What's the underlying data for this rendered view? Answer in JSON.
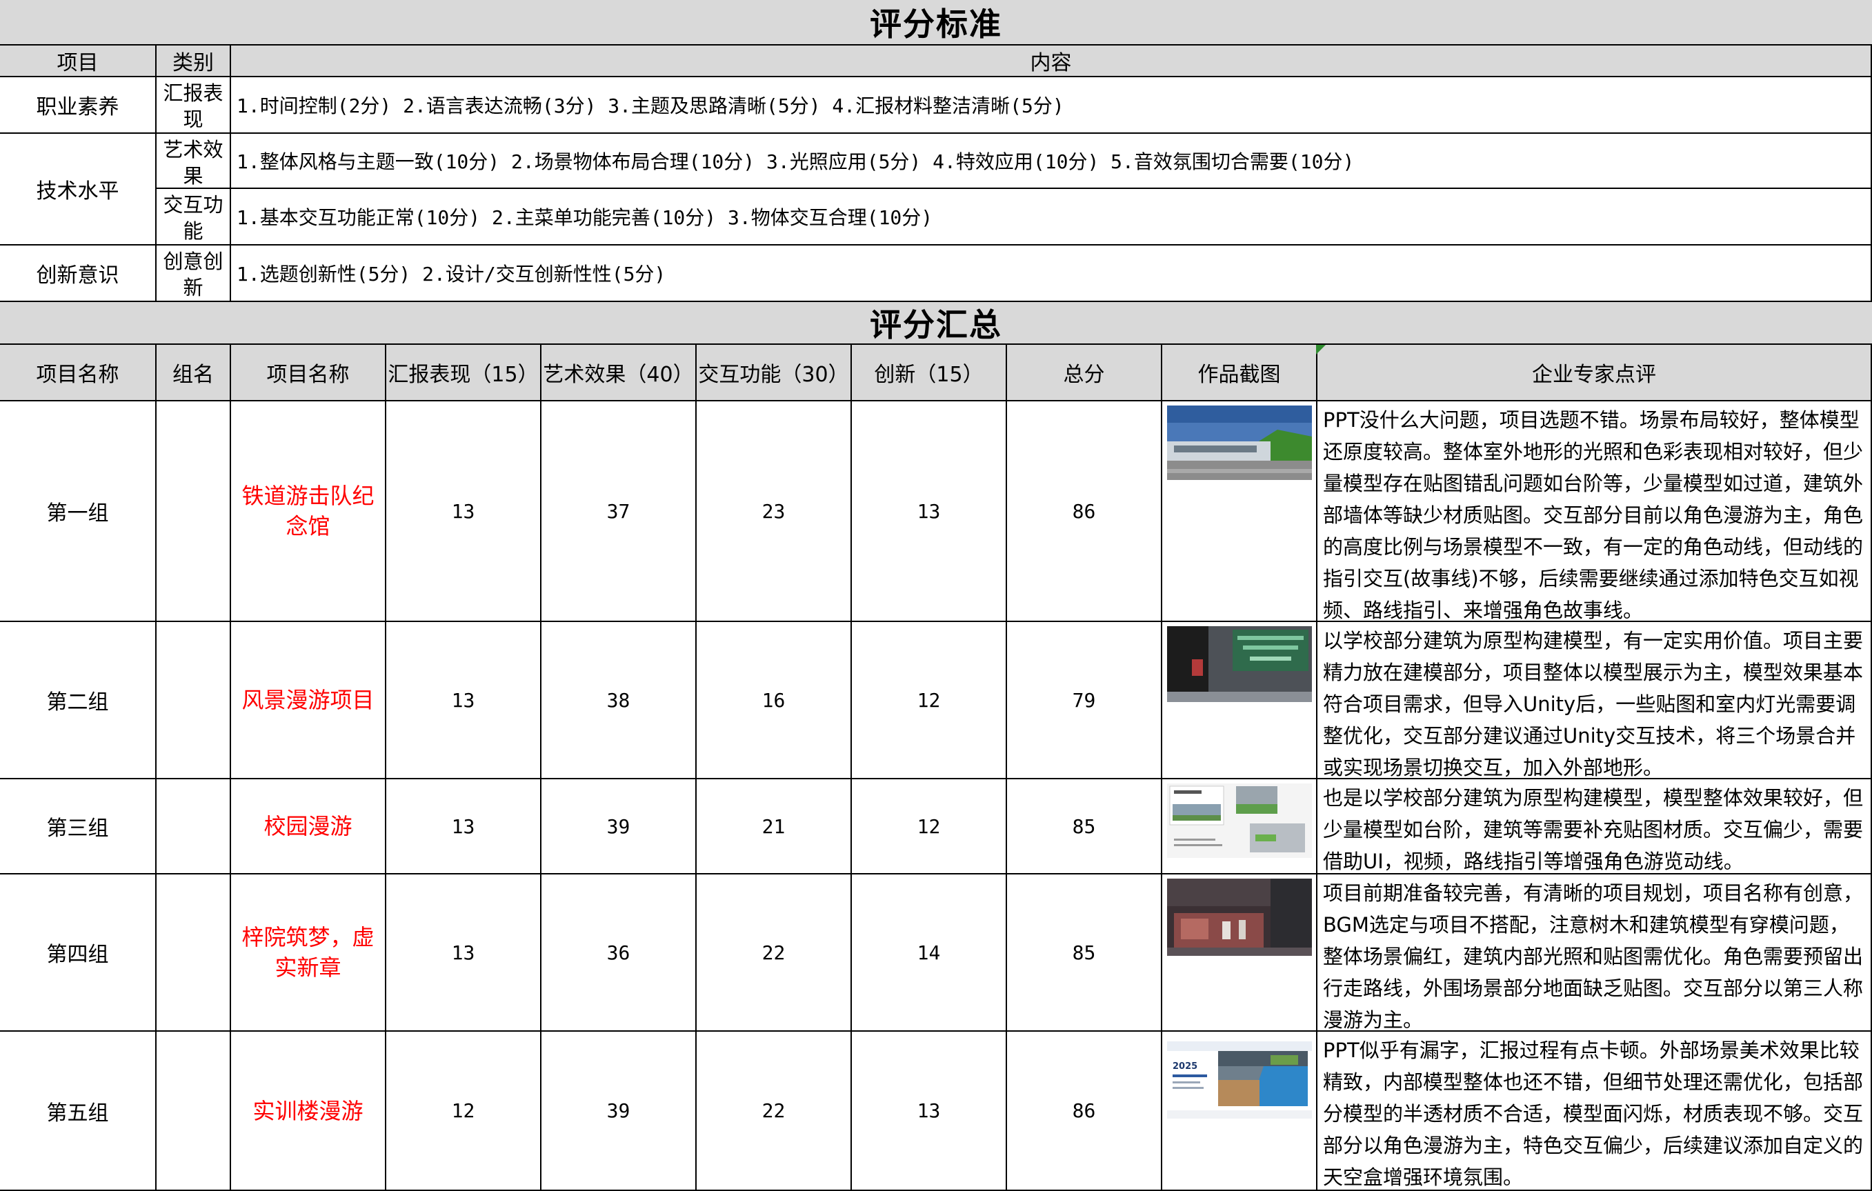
{
  "standard": {
    "title": "评分标准",
    "headers": {
      "item": "项目",
      "category": "类别",
      "content": "内容"
    },
    "rows": [
      {
        "item": "职业素养",
        "category": "汇报表现",
        "content": "1.时间控制(2分) 2.语言表达流畅(3分) 3.主题及思路清晰(5分) 4.汇报材料整洁清晰(5分)"
      },
      {
        "item": "技术水平",
        "category": "艺术效果",
        "content": "1.整体风格与主题一致(10分) 2.场景物体布局合理(10分) 3.光照应用(5分) 4.特效应用(10分) 5.音效氛围切合需要(10分)"
      },
      {
        "item": "",
        "category": "交互功能",
        "content": "1.基本交互功能正常(10分)  2.主菜单功能完善(10分)  3.物体交互合理(10分)"
      },
      {
        "item": "创新意识",
        "category": "创意创新",
        "content": "1.选题创新性(5分)  2.设计/交互创新性性(5分)"
      }
    ]
  },
  "summary": {
    "title": "评分汇总",
    "headers": {
      "group_label": "项目名称",
      "team": "组名",
      "project": "项目名称",
      "report": "汇报表现（15）",
      "art": "艺术效果（40）",
      "interaction": "交互功能（30）",
      "innovation": "创新（15）",
      "total": "总分",
      "screenshot": "作品截图",
      "review": "企业专家点评"
    },
    "rows": [
      {
        "group": "第一组",
        "team": "",
        "project": "铁道游击队纪念馆",
        "report": "13",
        "art": "37",
        "interaction": "23",
        "innovation": "13",
        "total": "86",
        "review": "PPT没什么大问题，项目选题不错。场景布局较好，整体模型还原度较高。整体室外地形的光照和色彩表现相对较好，但少量模型存在贴图错乱问题如台阶等，少量模型如过道，建筑外部墙体等缺少材质贴图。交互部分目前以角色漫游为主，角色的高度比例与场景模型不一致，有一定的角色动线，但动线的指引交互(故事线)不够，后续需要继续通过添加特色交互如视频、路线指引、来增强角色故事线。"
      },
      {
        "group": "第二组",
        "team": "",
        "project": "风景漫游项目",
        "report": "13",
        "art": "38",
        "interaction": "16",
        "innovation": "12",
        "total": "79",
        "review": "以学校部分建筑为原型构建模型，有一定实用价值。项目主要精力放在建模部分，项目整体以模型展示为主，模型效果基本符合项目需求，但导入Unity后，一些贴图和室内灯光需要调整优化，交互部分建议通过Unity交互技术，将三个场景合并或实现场景切换交互，加入外部地形。"
      },
      {
        "group": "第三组",
        "team": "",
        "project": "校园漫游",
        "report": "13",
        "art": "39",
        "interaction": "21",
        "innovation": "12",
        "total": "85",
        "review": "也是以学校部分建筑为原型构建模型，模型整体效果较好，但少量模型如台阶，建筑等需要补充贴图材质。交互偏少，需要借助UI，视频，路线指引等增强角色游览动线。"
      },
      {
        "group": "第四组",
        "team": "",
        "project": "梓院筑梦，虚实新章",
        "report": "13",
        "art": "36",
        "interaction": "22",
        "innovation": "14",
        "total": "85",
        "review": "项目前期准备较完善，有清晰的项目规划，项目名称有创意，BGM选定与项目不搭配，注意树木和建筑模型有穿模问题，整体场景偏红，建筑内部光照和贴图需优化。角色需要预留出行走路线，外围场景部分地面缺乏贴图。交互部分以第三人称漫游为主。"
      },
      {
        "group": "第五组",
        "team": "",
        "project": "实训楼漫游",
        "report": "12",
        "art": "39",
        "interaction": "22",
        "innovation": "13",
        "total": "86",
        "review": "PPT似乎有漏字，汇报过程有点卡顿。外部场景美术效果比较精致，内部模型整体也还不错，但细节处理还需优化，包括部分模型的半透材质不合适，模型面闪烁，材质表现不够。交互部分以角色漫游为主，特色交互偏少，后续建议添加自定义的天空盒增强环境氛围。"
      }
    ],
    "thumbs": {
      "t5_text": "2025"
    }
  }
}
